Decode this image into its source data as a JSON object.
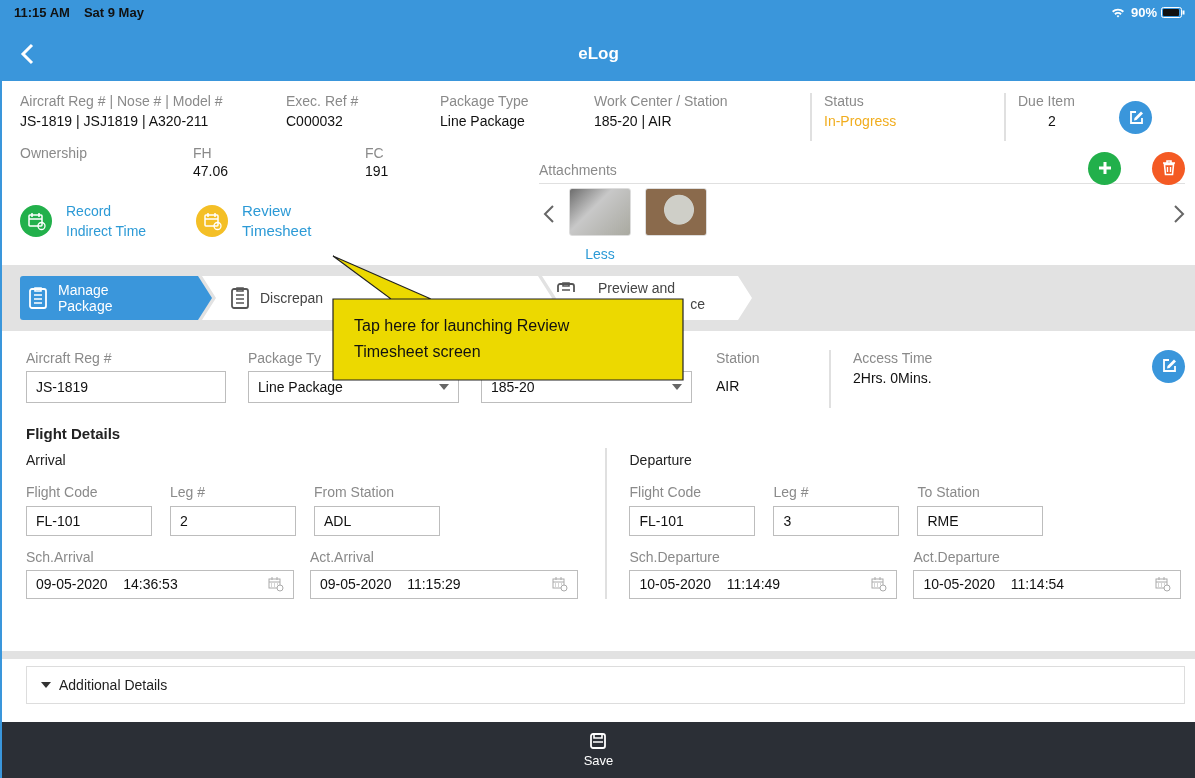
{
  "status_bar": {
    "time": "11:15 AM",
    "date": "Sat 9 May",
    "battery": "90%"
  },
  "nav": {
    "title": "eLog"
  },
  "summary": {
    "fields": [
      {
        "label": "Aircraft Reg # | Nose # | Model #",
        "value": "JS-1819 | JSJ1819 | A320-211",
        "kind": "text"
      },
      {
        "label": "Exec. Ref #",
        "value": "C000032",
        "kind": "text"
      },
      {
        "label": "Package Type",
        "value": "Line Package",
        "kind": "text"
      },
      {
        "label": "Work Center / Station",
        "value": "185-20 | AIR",
        "kind": "text"
      },
      {
        "label": "Status",
        "value": "In-Progress",
        "kind": "status"
      },
      {
        "label": "Due Item",
        "value": "2",
        "kind": "count"
      }
    ],
    "counters": [
      {
        "label": "Ownership"
      },
      {
        "label": "FH",
        "value": "47.06"
      },
      {
        "label": "FC",
        "value": "191"
      }
    ],
    "actions": [
      {
        "lines": [
          "Record",
          "Indirect Time"
        ],
        "kind": "record"
      },
      {
        "lines": [
          "Review",
          "Timesheet"
        ],
        "kind": "review"
      }
    ]
  },
  "attachments": {
    "title": "Attachments",
    "toggle": "Less"
  },
  "steps": [
    {
      "lines": [
        "Manage",
        "Package"
      ],
      "selected": true
    },
    {
      "lines": [
        "Discrepan"
      ],
      "selected": false
    },
    {
      "lines": [
        "Preview and",
        "ce"
      ],
      "selected": false
    }
  ],
  "package": {
    "fields": [
      {
        "label": "Aircraft Reg #",
        "value": "JS-1819",
        "kind": "input"
      },
      {
        "label": "Package Ty",
        "value": "Line Package",
        "kind": "select"
      },
      {
        "value": "185-20",
        "kind": "select"
      },
      {
        "label": "Station",
        "value": "AIR",
        "kind": "text"
      },
      {
        "label": "Access Time",
        "value": "2Hrs. 0Mins.",
        "kind": "text"
      }
    ]
  },
  "flight_details": {
    "title": "Flight Details",
    "sections": [
      {
        "title": "Arrival",
        "fields": [
          {
            "label": "Flight Code",
            "value": "FL-101"
          },
          {
            "label": "Leg #",
            "value": "2"
          },
          {
            "label": "From Station",
            "value": "ADL"
          }
        ],
        "dates": [
          {
            "label": "Sch.Arrival",
            "date": "09-05-2020",
            "time": "14:36:53"
          },
          {
            "label": "Act.Arrival",
            "date": "09-05-2020",
            "time": "11:15:29"
          }
        ]
      },
      {
        "title": "Departure",
        "fields": [
          {
            "label": "Flight Code",
            "value": "FL-101"
          },
          {
            "label": "Leg #",
            "value": "3"
          },
          {
            "label": "To Station",
            "value": "RME"
          }
        ],
        "dates": [
          {
            "label": "Sch.Departure",
            "date": "10-05-2020",
            "time": "11:14:49"
          },
          {
            "label": "Act.Departure",
            "date": "10-05-2020",
            "time": "11:14:54"
          }
        ]
      }
    ]
  },
  "additional_details": {
    "label": "Additional Details"
  },
  "callout": {
    "text": "Tap here for launching Review Timesheet screen"
  },
  "save": {
    "label": "Save"
  }
}
